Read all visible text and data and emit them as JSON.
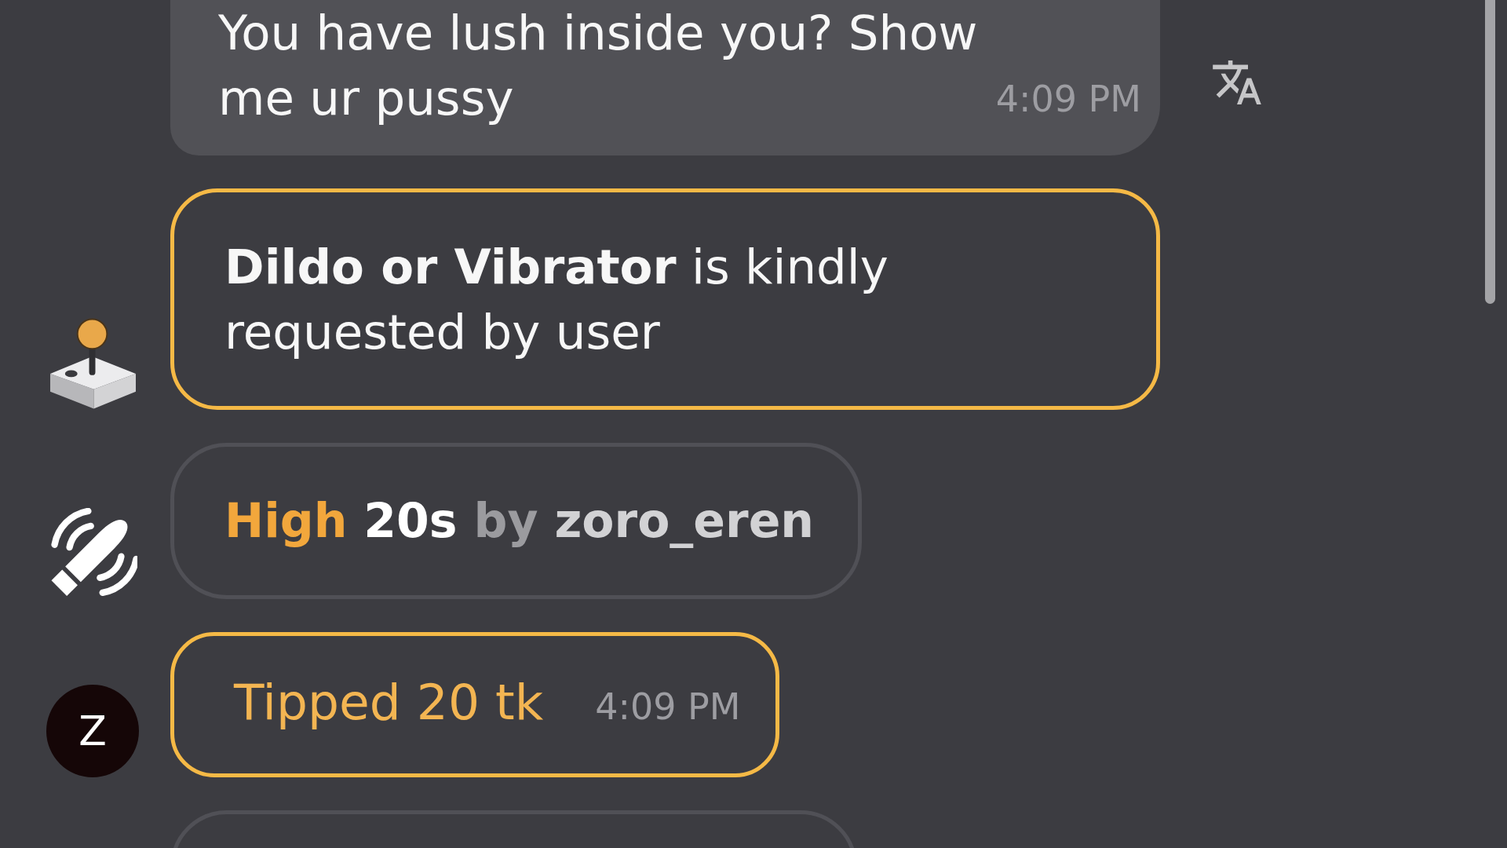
{
  "messages": [
    {
      "kind": "chat",
      "text": "You have lush inside you? Show me ur pussy",
      "time": "4:09 PM",
      "translate_button": true
    },
    {
      "kind": "request",
      "badge": {
        "kind": "joystick"
      },
      "text": "**Dildo or Vibrator** is kindly requested by user"
    },
    {
      "kind": "vibe",
      "badge": {
        "kind": "vibrator"
      },
      "parts": [
        {
          "text": "High",
          "kind": "accent"
        },
        {
          "text": "20s",
          "kind": "bright"
        },
        {
          "text": "by",
          "kind": "muted"
        },
        {
          "text": "zoro_eren",
          "kind": "soft"
        }
      ]
    },
    {
      "kind": "tip",
      "avatar": {
        "initial": "Z"
      },
      "text": "Tipped 20 tk",
      "time": "4:09 PM"
    },
    {
      "kind": "event"
    }
  ]
}
